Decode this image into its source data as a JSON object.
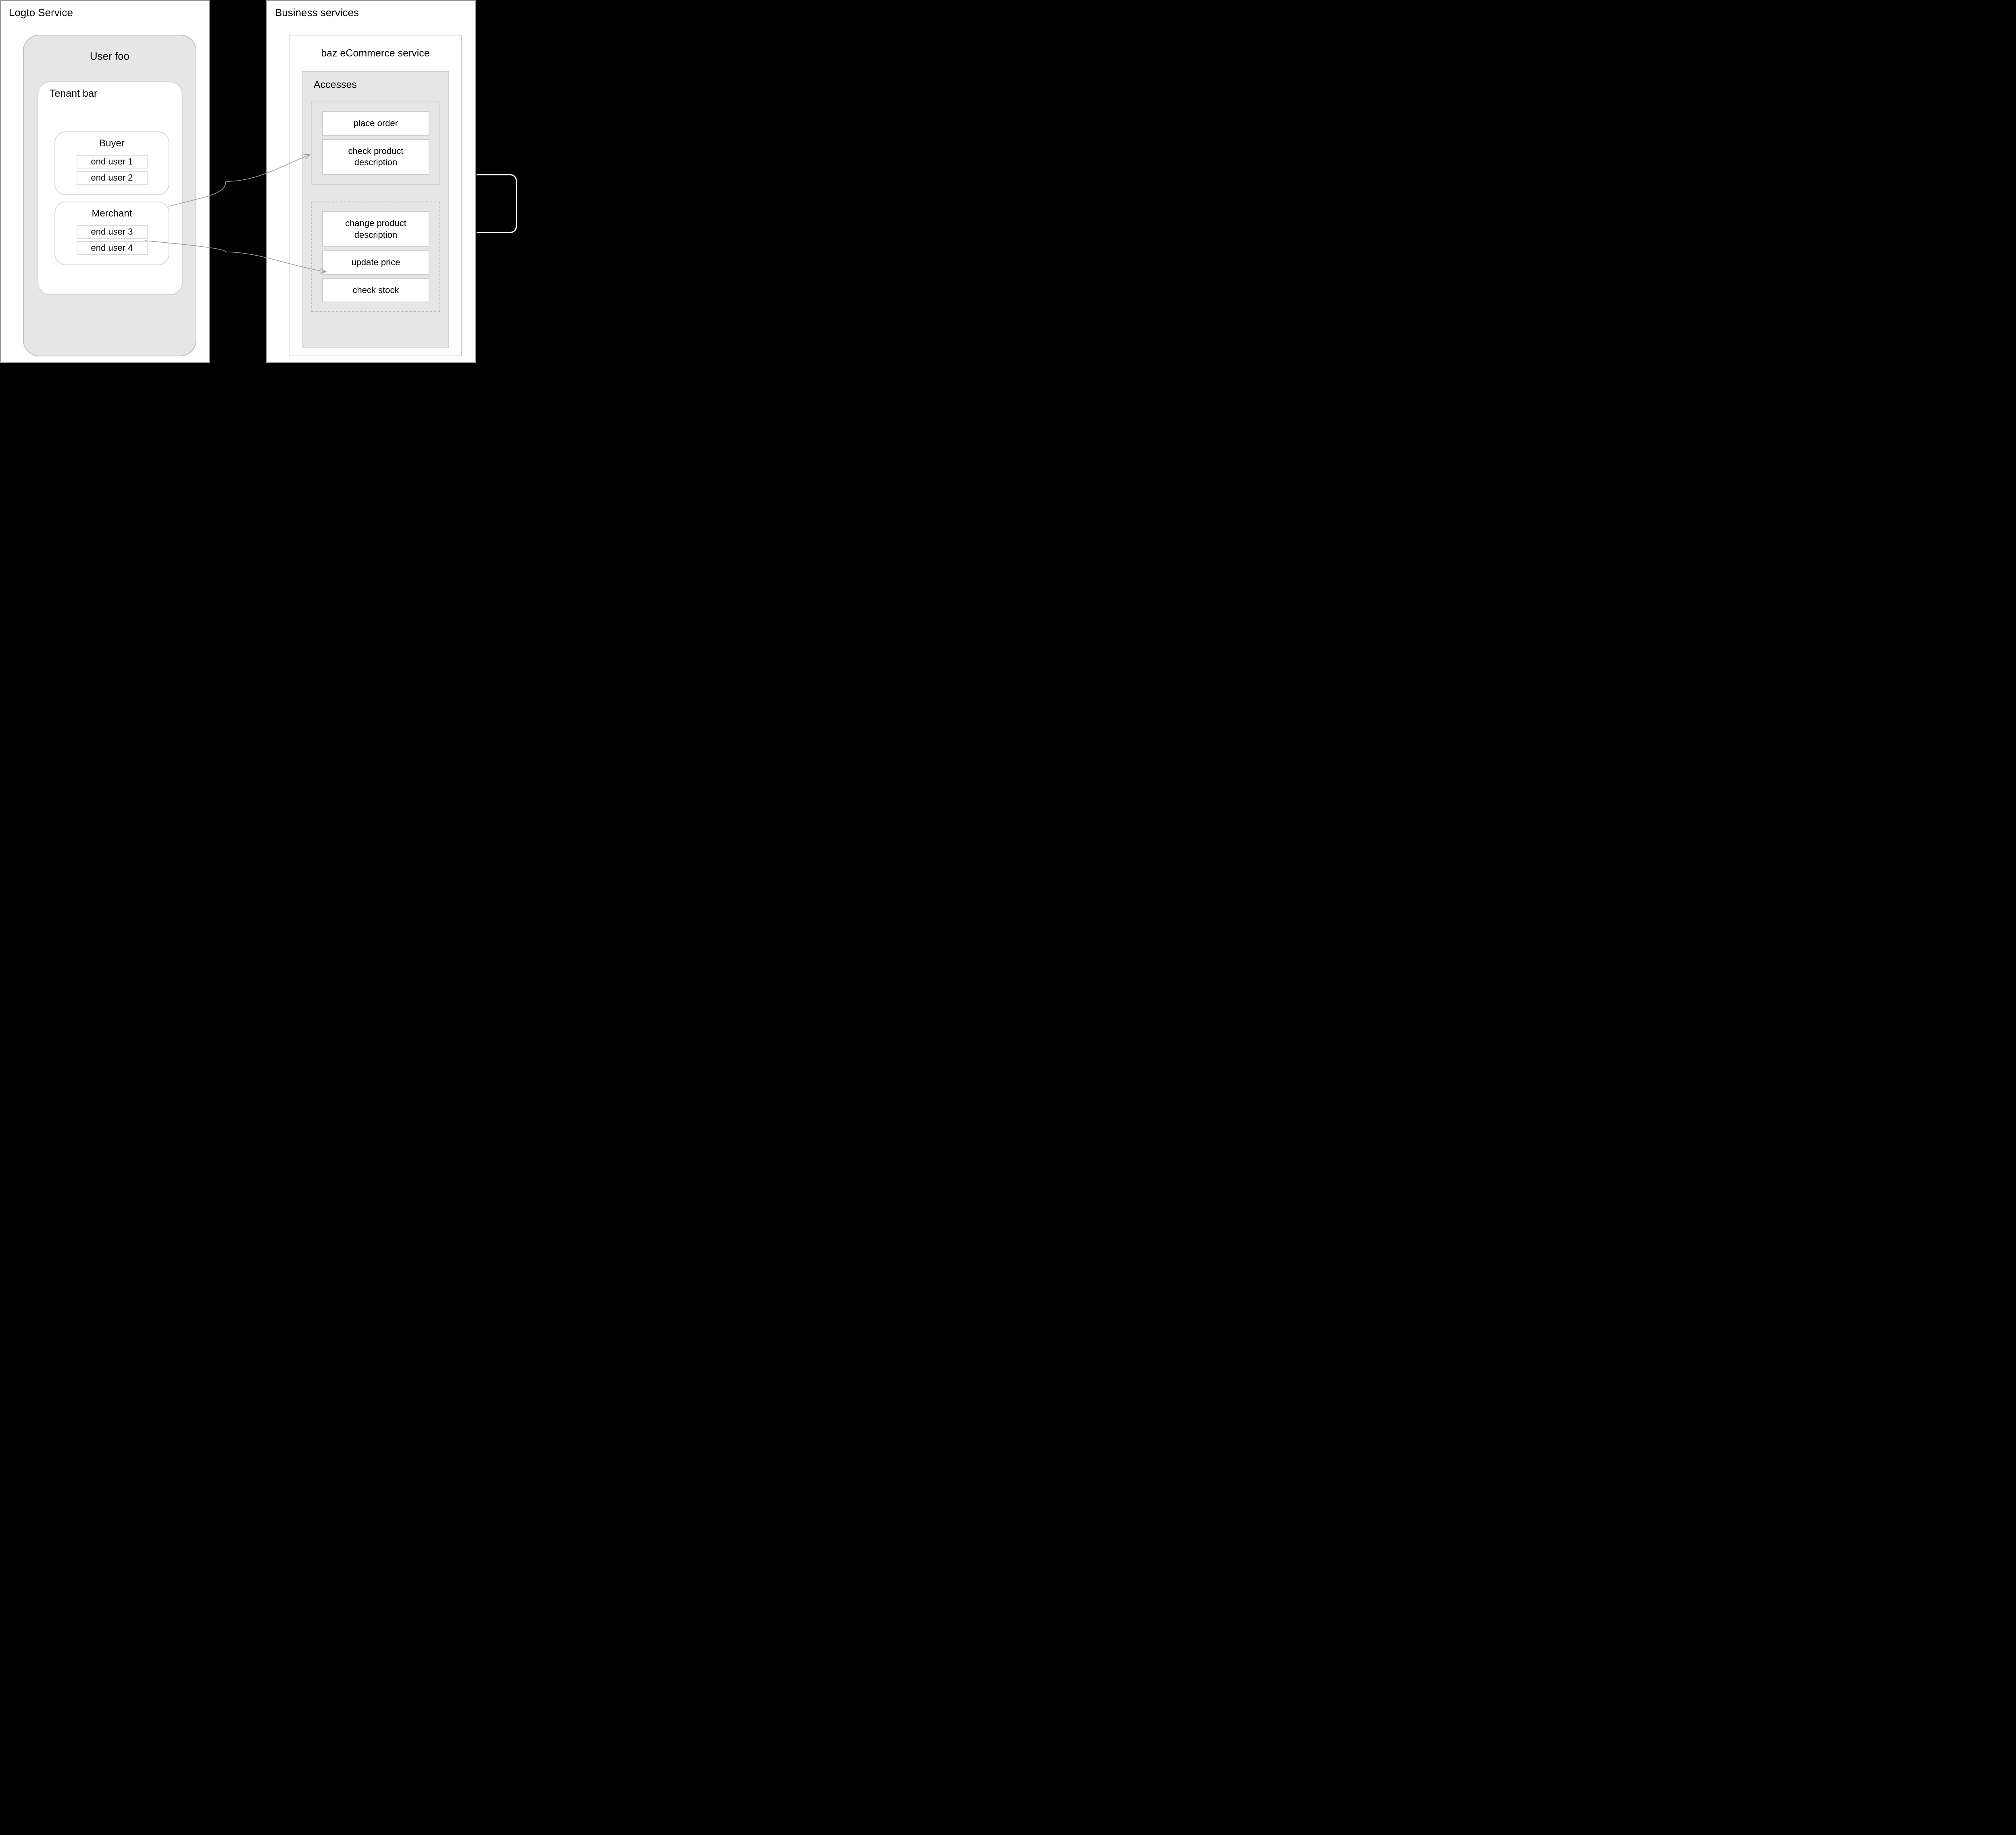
{
  "left": {
    "title": "Logto Service",
    "user": {
      "title": "User foo",
      "tenant": {
        "title": "Tenant bar",
        "roles": [
          {
            "title": "Buyer",
            "users": [
              "end user 1",
              "end user 2"
            ]
          },
          {
            "title": "Merchant",
            "users": [
              "end user 3",
              "end user 4"
            ]
          }
        ]
      }
    }
  },
  "right": {
    "title": "Business services",
    "service": {
      "title": "baz eCommerce service",
      "accesses": {
        "title": "Accesses",
        "groups": [
          {
            "style": "solid",
            "perms": [
              "place order",
              "check product description"
            ]
          },
          {
            "style": "dashed",
            "perms": [
              "change product description",
              "update price",
              "check stock"
            ]
          }
        ]
      }
    }
  },
  "arrows": [
    {
      "from": "buyer",
      "to": "group-top"
    },
    {
      "from": "merchant",
      "to": "group-bottom"
    }
  ]
}
